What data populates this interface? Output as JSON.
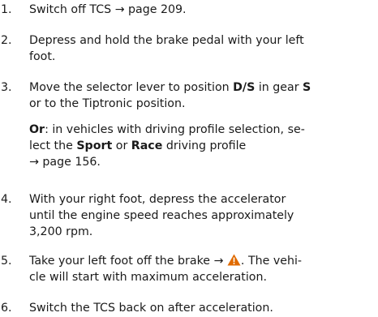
{
  "colors": {
    "text": "#1a1a1a",
    "warning_fill": "#e06a00",
    "warning_mark": "#ffffff"
  },
  "icons": {
    "warning": "warning-triangle-icon",
    "arrow": "right-arrow"
  },
  "steps": [
    {
      "number": "1.",
      "text_a": "Switch off TCS → page 209."
    },
    {
      "number": "2.",
      "line1": "Depress and hold the brake pedal with your left",
      "line2": "foot."
    },
    {
      "number": "3.",
      "a": "Move the selector lever to position ",
      "b": "D/S",
      "c": " in gear ",
      "d": "S",
      "line2": "or to the Tiptronic position.",
      "or_label": "Or",
      "or_a": ": in vehicles with driving profile selection, se-",
      "or_b": "lect the ",
      "sport": "Sport",
      "or_c": " or ",
      "race": "Race",
      "or_d": " driving profile",
      "or_e": "→ page 156."
    },
    {
      "number": "4.",
      "line1": "With your right foot, depress the accelerator",
      "line2": "until the engine speed reaches approximately",
      "line3": "3,200 rpm."
    },
    {
      "number": "5.",
      "a": "Take your left foot off the brake → ",
      "b": ". The vehi-",
      "line2": "cle will start with maximum acceleration."
    },
    {
      "number": "6.",
      "line1": "Switch the TCS back on after acceleration."
    }
  ]
}
